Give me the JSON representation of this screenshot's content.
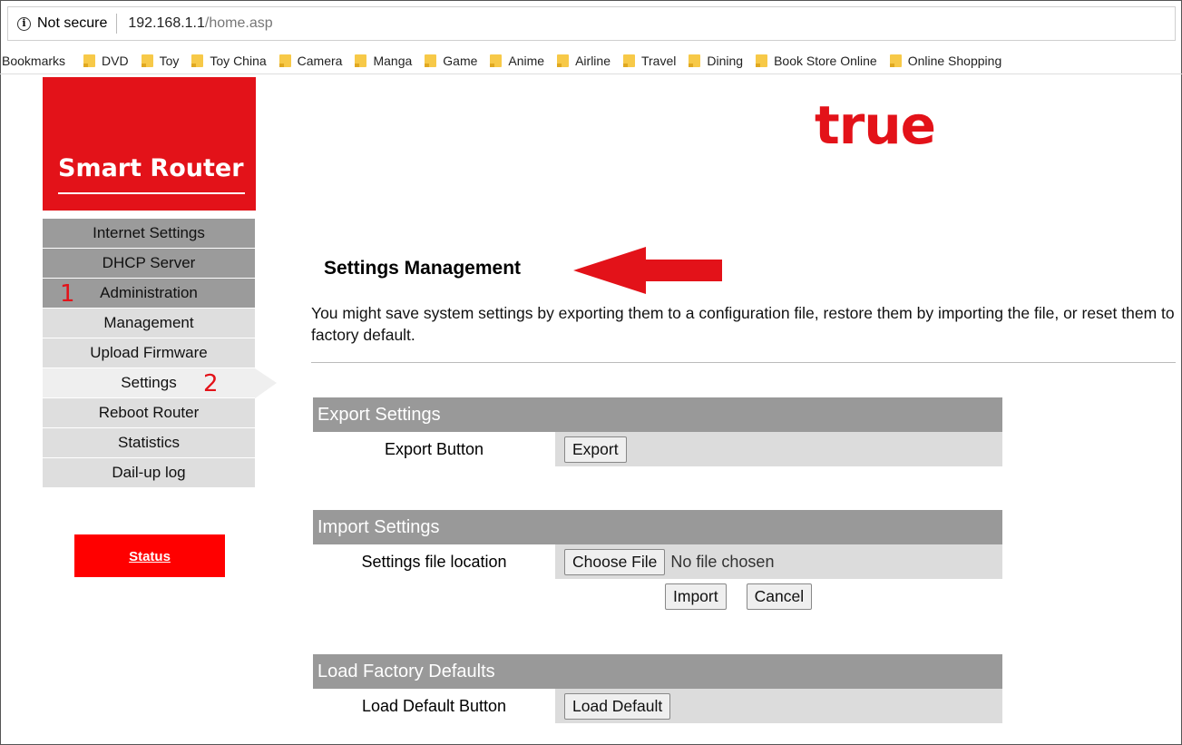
{
  "browser": {
    "security": "Not secure",
    "url_host": "192.168.1.1",
    "url_path": "/home.asp",
    "bookmarks_label": "Bookmarks",
    "bookmarks": [
      "DVD",
      "Toy",
      "Toy China",
      "Camera",
      "Manga",
      "Game",
      "Anime",
      "Airline",
      "Travel",
      "Dining",
      "Book Store Online",
      "Online Shopping"
    ]
  },
  "sidebar": {
    "logo": "Smart Router",
    "items": [
      {
        "label": "Internet Settings"
      },
      {
        "label": "DHCP Server"
      },
      {
        "label": "Administration"
      },
      {
        "label": "Management"
      },
      {
        "label": "Upload Firmware"
      },
      {
        "label": "Settings"
      },
      {
        "label": "Reboot Router"
      },
      {
        "label": "Statistics"
      },
      {
        "label": "Dail-up log"
      }
    ],
    "annotation_1": "1",
    "annotation_2": "2",
    "status": "Status"
  },
  "brand": "true",
  "main": {
    "title": "Settings Management",
    "description": "You might save system settings by exporting them to a configuration file, restore them by importing the file, or reset them to factory default.",
    "export": {
      "header": "Export Settings",
      "label": "Export Button",
      "button": "Export"
    },
    "import": {
      "header": "Import Settings",
      "label": "Settings file location",
      "choose": "Choose File",
      "nofile": "No file chosen",
      "import_button": "Import",
      "cancel_button": "Cancel"
    },
    "factory": {
      "header": "Load Factory Defaults",
      "label": "Load Default Button",
      "button": "Load Default"
    }
  },
  "colors": {
    "brand_red": "#e31219",
    "menu_dark": "#9b9b9b",
    "menu_light": "#dedede"
  }
}
